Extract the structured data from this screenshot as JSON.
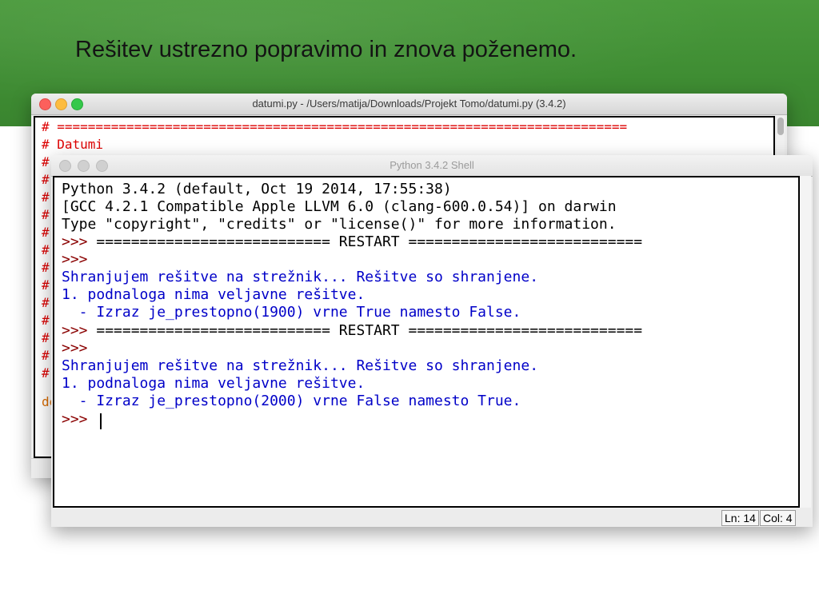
{
  "slide": {
    "title": "Rešitev ustrezno popravimo in znova poženemo."
  },
  "editor_window": {
    "title": "datumi.py - /Users/matija/Downloads/Projekt Tomo/datumi.py (3.4.2)",
    "lines": [
      "# ==========================================================================",
      "# Datumi",
      "#",
      "#",
      "#",
      "#",
      "#",
      "#",
      "#",
      "#",
      "#",
      "#",
      "#",
      "#",
      "#",
      "",
      "de"
    ]
  },
  "shell_window": {
    "title": "Python 3.4.2 Shell",
    "header_lines": [
      "Python 3.4.2 (default, Oct 19 2014, 17:55:38)",
      "[GCC 4.2.1 Compatible Apple LLVM 6.0 (clang-600.0.54)] on darwin",
      "Type \"copyright\", \"credits\" or \"license()\" for more information."
    ],
    "prompt": ">>>",
    "restart_line": " =========================== RESTART ===========================",
    "run1": [
      "Shranjujem rešitve na strežnik... Rešitve so shranjene.",
      "1. podnaloga nima veljavne rešitve.",
      "  - Izraz je_prestopno(1900) vrne True namesto False."
    ],
    "run2": [
      "Shranjujem rešitve na strežnik... Rešitve so shranjene.",
      "1. podnaloga nima veljavne rešitve.",
      "  - Izraz je_prestopno(2000) vrne False namesto True."
    ],
    "status": {
      "line": "Ln: 14",
      "col": "Col: 4"
    }
  },
  "colors": {
    "header_green": "#3f8d33",
    "code_comment": "#dd0000",
    "shell_output": "#0000c8",
    "prompt": "#8a0000"
  }
}
